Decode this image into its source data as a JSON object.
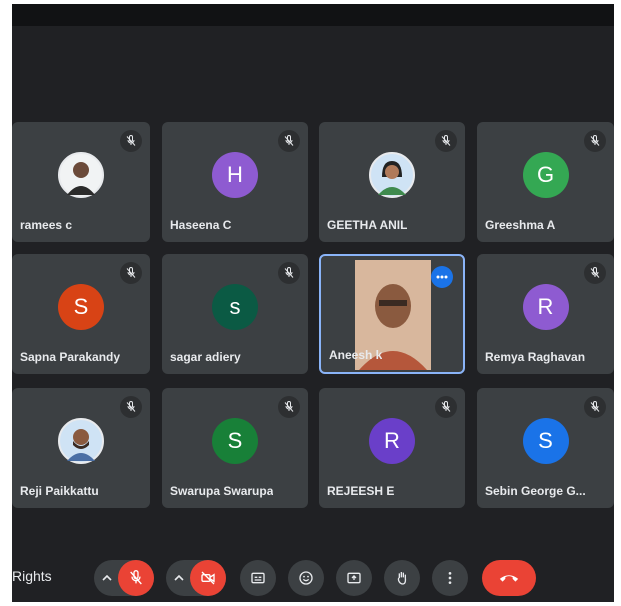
{
  "participants": [
    {
      "name": "ramees c",
      "initial": "",
      "avatar_type": "photo",
      "avatar_color": "#f1f3f4"
    },
    {
      "name": "Haseena C",
      "initial": "H",
      "avatar_type": "letter",
      "avatar_color": "#8e5bd1"
    },
    {
      "name": "GEETHA ANIL",
      "initial": "",
      "avatar_type": "photo",
      "avatar_color": "#cfe3f5"
    },
    {
      "name": "Greeshma A",
      "initial": "G",
      "avatar_type": "letter",
      "avatar_color": "#34a853"
    },
    {
      "name": "Sapna Parakandy",
      "initial": "S",
      "avatar_type": "letter",
      "avatar_color": "#d84315"
    },
    {
      "name": "sagar adiery",
      "initial": "s",
      "avatar_type": "letter",
      "avatar_color": "#0b5a44"
    },
    {
      "name": "Aneesh k",
      "initial": "",
      "avatar_type": "video",
      "avatar_color": "#c9a58a"
    },
    {
      "name": "Remya Raghavan",
      "initial": "R",
      "avatar_type": "letter",
      "avatar_color": "#8e5bd1"
    },
    {
      "name": "Reji Paikkattu",
      "initial": "",
      "avatar_type": "photo",
      "avatar_color": "#cfe3f5"
    },
    {
      "name": "Swarupa Swarupa",
      "initial": "S",
      "avatar_type": "letter",
      "avatar_color": "#188038"
    },
    {
      "name": "REJEESH E",
      "initial": "R",
      "avatar_type": "letter",
      "avatar_color": "#6a3fc9"
    },
    {
      "name": "Sebin George G...",
      "initial": "S",
      "avatar_type": "letter",
      "avatar_color": "#1a73e8"
    }
  ],
  "controls": {
    "left_text": "Rights",
    "icons": [
      "mic-off-icon",
      "camera-off-icon",
      "captions-icon",
      "emoji-icon",
      "present-icon",
      "raise-hand-icon",
      "more-vert-icon",
      "hang-up-icon"
    ]
  },
  "colors": {
    "danger": "#ea4335",
    "active_border": "#8ab4f8",
    "tile_bg": "#3c4043"
  }
}
